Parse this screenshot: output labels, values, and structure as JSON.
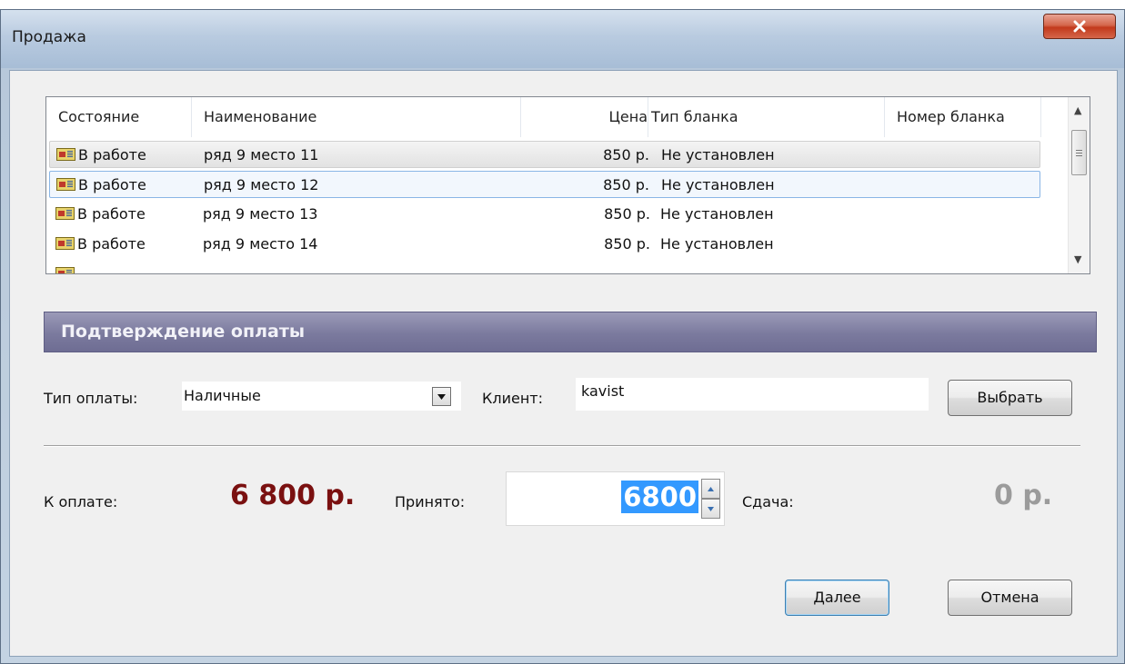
{
  "window": {
    "title": "Продажа"
  },
  "list": {
    "columns": [
      "Состояние",
      "Наименование",
      "Цена",
      "Тип бланка",
      "Номер бланка"
    ],
    "rows": [
      {
        "state": "В работе",
        "name": "ряд 9 место 11",
        "price": "850 р.",
        "form_type": "Не установлен",
        "form_number": ""
      },
      {
        "state": "В работе",
        "name": "ряд 9 место 12",
        "price": "850 р.",
        "form_type": "Не установлен",
        "form_number": ""
      },
      {
        "state": "В работе",
        "name": "ряд 9 место 13",
        "price": "850 р.",
        "form_type": "Не установлен",
        "form_number": ""
      },
      {
        "state": "В работе",
        "name": "ряд 9 место 14",
        "price": "850 р.",
        "form_type": "Не установлен",
        "form_number": ""
      }
    ]
  },
  "payment": {
    "section_title": "Подтверждение оплаты",
    "type_label": "Тип оплаты:",
    "type_value": "Наличные",
    "client_label": "Клиент:",
    "client_value": "kavist",
    "choose_button": "Выбрать",
    "due_label": "К оплате:",
    "due_value": "6 800 р.",
    "accepted_label": "Принято:",
    "accepted_value": "6800",
    "change_label": "Сдача:",
    "change_value": "0 р."
  },
  "buttons": {
    "next": "Далее",
    "cancel": "Отмена"
  },
  "colors": {
    "amount_due": "#7a1010",
    "section_header": "#7b7a9e",
    "selection": "#3399ff"
  }
}
